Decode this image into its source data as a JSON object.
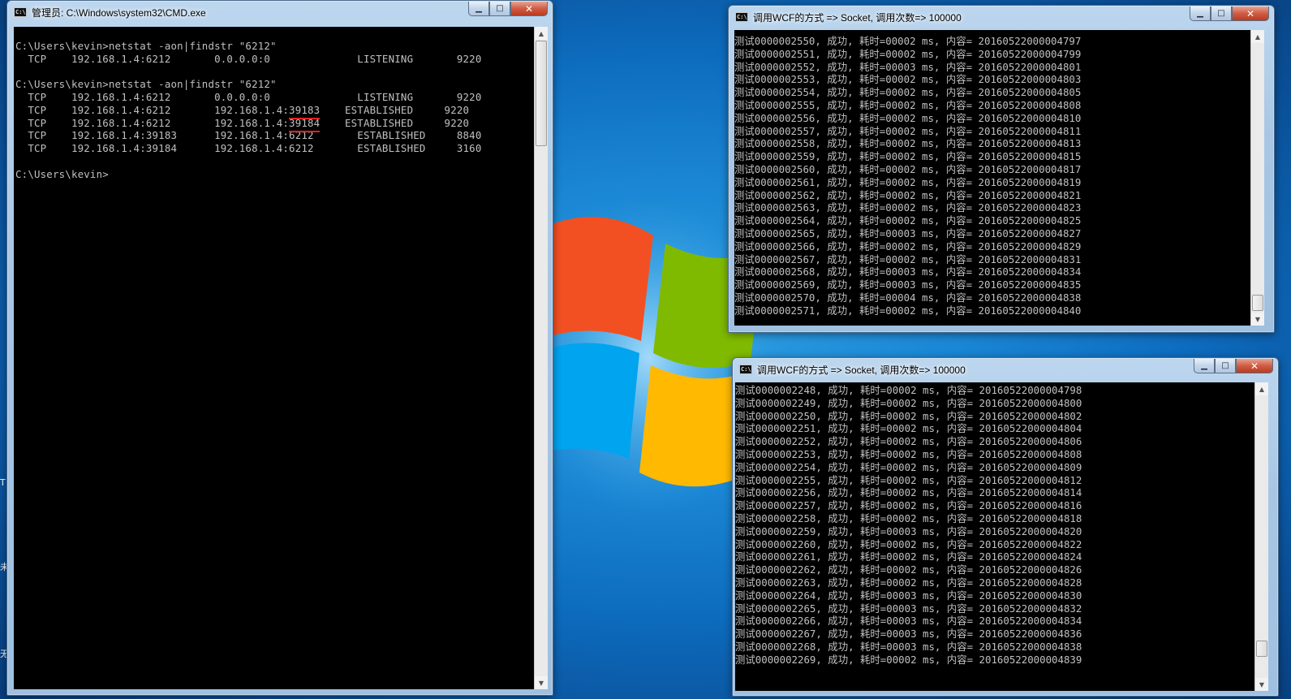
{
  "cmd_window": {
    "title": "管理员: C:\\Windows\\system32\\CMD.exe",
    "icon_label": "C:\\",
    "lines": [
      {
        "text": ""
      },
      {
        "text": "C:\\Users\\kevin>netstat -aon|findstr \"6212\""
      },
      {
        "text": "  TCP    192.168.1.4:6212       0.0.0.0:0              LISTENING       9220"
      },
      {
        "text": ""
      },
      {
        "text": "C:\\Users\\kevin>netstat -aon|findstr \"6212\""
      },
      {
        "text": "  TCP    192.168.1.4:6212       0.0.0.0:0              LISTENING       9220"
      },
      {
        "pre": "  TCP    192.168.1.4:6212       192.168.1.4:",
        "hl": "39183",
        "post": "    ESTABLISHED     9220"
      },
      {
        "pre": "  TCP    192.168.1.4:6212       192.168.1.4:",
        "hl": "39184",
        "post": "    ESTABLISHED     9220"
      },
      {
        "text": "  TCP    192.168.1.4:39183      192.168.1.4:6212       ESTABLISHED     8840"
      },
      {
        "text": "  TCP    192.168.1.4:39184      192.168.1.4:6212       ESTABLISHED     3160"
      },
      {
        "text": ""
      },
      {
        "text": "C:\\Users\\kevin>"
      }
    ]
  },
  "socket_window_top": {
    "title": "调用WCF的方式 => Socket, 调用次数=> 100000",
    "lines": [
      "测试0000002550, 成功, 耗时=00002 ms, 内容= 20160522000004797",
      "测试0000002551, 成功, 耗时=00002 ms, 内容= 20160522000004799",
      "测试0000002552, 成功, 耗时=00003 ms, 内容= 20160522000004801",
      "测试0000002553, 成功, 耗时=00002 ms, 内容= 20160522000004803",
      "测试0000002554, 成功, 耗时=00002 ms, 内容= 20160522000004805",
      "测试0000002555, 成功, 耗时=00002 ms, 内容= 20160522000004808",
      "测试0000002556, 成功, 耗时=00002 ms, 内容= 20160522000004810",
      "测试0000002557, 成功, 耗时=00002 ms, 内容= 20160522000004811",
      "测试0000002558, 成功, 耗时=00002 ms, 内容= 20160522000004813",
      "测试0000002559, 成功, 耗时=00002 ms, 内容= 20160522000004815",
      "测试0000002560, 成功, 耗时=00002 ms, 内容= 20160522000004817",
      "测试0000002561, 成功, 耗时=00002 ms, 内容= 20160522000004819",
      "测试0000002562, 成功, 耗时=00002 ms, 内容= 20160522000004821",
      "测试0000002563, 成功, 耗时=00002 ms, 内容= 20160522000004823",
      "测试0000002564, 成功, 耗时=00002 ms, 内容= 20160522000004825",
      "测试0000002565, 成功, 耗时=00003 ms, 内容= 20160522000004827",
      "测试0000002566, 成功, 耗时=00002 ms, 内容= 20160522000004829",
      "测试0000002567, 成功, 耗时=00002 ms, 内容= 20160522000004831",
      "测试0000002568, 成功, 耗时=00003 ms, 内容= 20160522000004834",
      "测试0000002569, 成功, 耗时=00003 ms, 内容= 20160522000004835",
      "测试0000002570, 成功, 耗时=00004 ms, 内容= 20160522000004838",
      "测试0000002571, 成功, 耗时=00002 ms, 内容= 20160522000004840"
    ]
  },
  "socket_window_bottom": {
    "title": "调用WCF的方式 => Socket, 调用次数=> 100000",
    "lines": [
      "测试0000002248, 成功, 耗时=00002 ms, 内容= 20160522000004798",
      "测试0000002249, 成功, 耗时=00002 ms, 内容= 20160522000004800",
      "测试0000002250, 成功, 耗时=00002 ms, 内容= 20160522000004802",
      "测试0000002251, 成功, 耗时=00002 ms, 内容= 20160522000004804",
      "测试0000002252, 成功, 耗时=00002 ms, 内容= 20160522000004806",
      "测试0000002253, 成功, 耗时=00002 ms, 内容= 20160522000004808",
      "测试0000002254, 成功, 耗时=00002 ms, 内容= 20160522000004809",
      "测试0000002255, 成功, 耗时=00002 ms, 内容= 20160522000004812",
      "测试0000002256, 成功, 耗时=00002 ms, 内容= 20160522000004814",
      "测试0000002257, 成功, 耗时=00002 ms, 内容= 20160522000004816",
      "测试0000002258, 成功, 耗时=00002 ms, 内容= 20160522000004818",
      "测试0000002259, 成功, 耗时=00003 ms, 内容= 20160522000004820",
      "测试0000002260, 成功, 耗时=00002 ms, 内容= 20160522000004822",
      "测试0000002261, 成功, 耗时=00002 ms, 内容= 20160522000004824",
      "测试0000002262, 成功, 耗时=00002 ms, 内容= 20160522000004826",
      "测试0000002263, 成功, 耗时=00002 ms, 内容= 20160522000004828",
      "测试0000002264, 成功, 耗时=00003 ms, 内容= 20160522000004830",
      "测试0000002265, 成功, 耗时=00003 ms, 内容= 20160522000004832",
      "测试0000002266, 成功, 耗时=00003 ms, 内容= 20160522000004834",
      "测试0000002267, 成功, 耗时=00003 ms, 内容= 20160522000004836",
      "测试0000002268, 成功, 耗时=00003 ms, 内容= 20160522000004838",
      "测试0000002269, 成功, 耗时=00002 ms, 内容= 20160522000004839"
    ]
  },
  "window_controls": {
    "minimize": "▁",
    "maximize": "□",
    "close": "✕"
  },
  "desktop_edge_text": [
    "T",
    "未",
    "无"
  ],
  "icons": [
    "console-icon",
    "minimize-icon",
    "maximize-icon",
    "close-icon",
    "scroll-up-arrow-icon",
    "scroll-down-arrow-icon",
    "windows-logo-icon"
  ]
}
